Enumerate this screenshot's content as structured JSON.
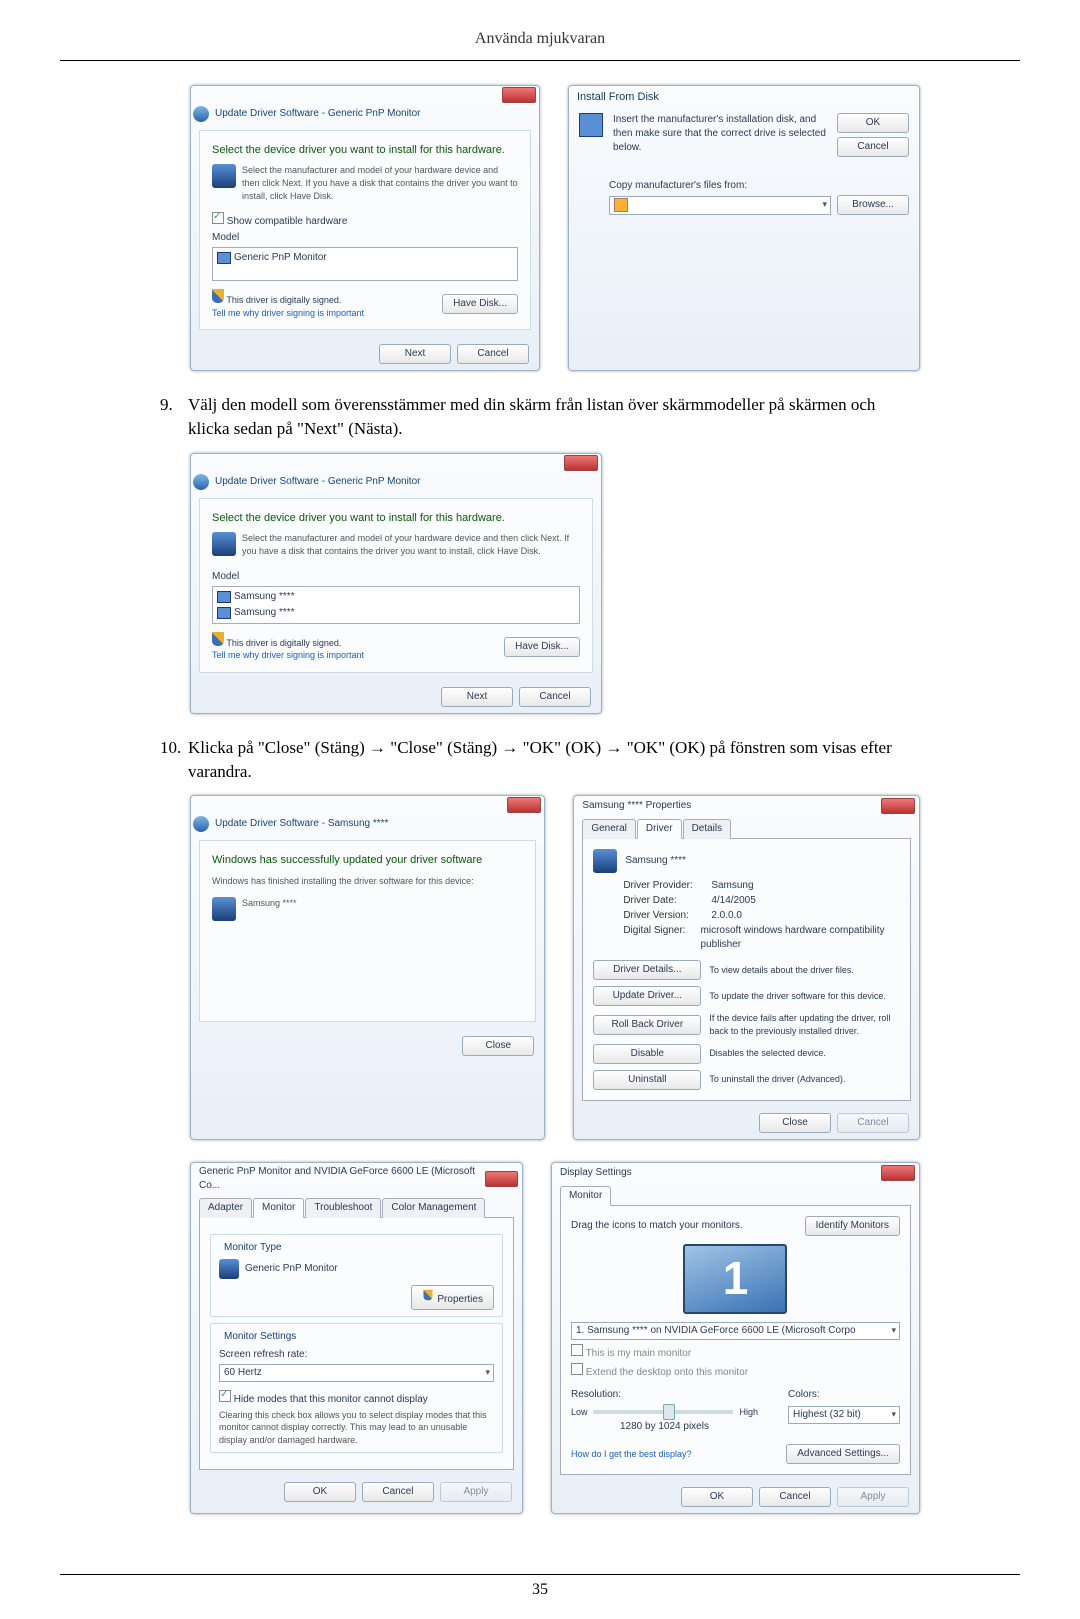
{
  "header": "Använda mjukvaran",
  "step9": {
    "num": "9.",
    "text": "Välj den modell som överensstämmer med din skärm från listan över skärmmodeller på skärmen och klicka sedan på \"Next\" (Nästa)."
  },
  "step10": {
    "num": "10.",
    "text": "Klicka på \"Close\" (Stäng) → \"Close\" (Stäng) → \"OK\" (OK) → \"OK\" (OK) på fönstren som visas efter varandra."
  },
  "d1": {
    "crumb": "Update Driver Software - Generic PnP Monitor",
    "title": "Select the device driver you want to install for this hardware.",
    "sub": "Select the manufacturer and model of your hardware device and then click Next. If you have a disk that contains the driver you want to install, click Have Disk.",
    "compat": "Show compatible hardware",
    "model": "Model",
    "item": "Generic PnP Monitor",
    "signed": "This driver is digitally signed.",
    "why": "Tell me why driver signing is important",
    "havedisk": "Have Disk...",
    "next": "Next",
    "cancel": "Cancel"
  },
  "d2": {
    "title": "Install From Disk",
    "msg": "Insert the manufacturer's installation disk, and then make sure that the correct drive is selected below.",
    "ok": "OK",
    "cancel": "Cancel",
    "copy": "Copy manufacturer's files from:",
    "browse": "Browse..."
  },
  "d3": {
    "crumb": "Update Driver Software - Generic PnP Monitor",
    "title": "Select the device driver you want to install for this hardware.",
    "sub": "Select the manufacturer and model of your hardware device and then click Next. If you have a disk that contains the driver you want to install, click Have Disk.",
    "model": "Model",
    "item1": "Samsung ****",
    "item2": "Samsung ****",
    "signed": "This driver is digitally signed.",
    "why": "Tell me why driver signing is important",
    "havedisk": "Have Disk...",
    "next": "Next",
    "cancel": "Cancel"
  },
  "d4": {
    "crumb": "Update Driver Software - Samsung ****",
    "title": "Windows has successfully updated your driver software",
    "sub": "Windows has finished installing the driver software for this device:",
    "item": "Samsung ****",
    "close": "Close"
  },
  "d5": {
    "windowtitle": "Samsung **** Properties",
    "tabs": [
      "General",
      "Driver",
      "Details"
    ],
    "device": "Samsung ****",
    "prov_k": "Driver Provider:",
    "prov_v": "Samsung",
    "date_k": "Driver Date:",
    "date_v": "4/14/2005",
    "ver_k": "Driver Version:",
    "ver_v": "2.0.0.0",
    "sign_k": "Digital Signer:",
    "sign_v": "microsoft windows hardware compatibility publisher",
    "b1": "Driver Details...",
    "t1": "To view details about the driver files.",
    "b2": "Update Driver...",
    "t2": "To update the driver software for this device.",
    "b3": "Roll Back Driver",
    "t3": "If the device fails after updating the driver, roll back to the previously installed driver.",
    "b4": "Disable",
    "t4": "Disables the selected device.",
    "b5": "Uninstall",
    "t5": "To uninstall the driver (Advanced).",
    "close": "Close",
    "cancel": "Cancel"
  },
  "d6": {
    "windowtitle": "Generic PnP Monitor and NVIDIA GeForce 6600 LE (Microsoft Co...",
    "tabs": [
      "Adapter",
      "Monitor",
      "Troubleshoot",
      "Color Management"
    ],
    "mtype": "Monitor Type",
    "mname": "Generic PnP Monitor",
    "properties": "Properties",
    "msettings": "Monitor Settings",
    "rr": "Screen refresh rate:",
    "rr_val": "60 Hertz",
    "hide": "Hide modes that this monitor cannot display",
    "hidedesc": "Clearing this check box allows you to select display modes that this monitor cannot display correctly. This may lead to an unusable display and/or damaged hardware.",
    "ok": "OK",
    "cancel": "Cancel",
    "apply": "Apply"
  },
  "d7": {
    "windowtitle": "Display Settings",
    "tab": "Monitor",
    "drag": "Drag the icons to match your monitors.",
    "identify": "Identify Monitors",
    "combo": "1. Samsung **** on NVIDIA GeForce 6600 LE (Microsoft Corpo",
    "main": "This is my main monitor",
    "extend": "Extend the desktop onto this monitor",
    "res": "Resolution:",
    "low": "Low",
    "high": "High",
    "res_val": "1280 by 1024 pixels",
    "colors": "Colors:",
    "colors_val": "Highest (32 bit)",
    "best": "How do I get the best display?",
    "adv": "Advanced Settings...",
    "ok": "OK",
    "cancel": "Cancel",
    "apply": "Apply"
  },
  "page_no": "35"
}
